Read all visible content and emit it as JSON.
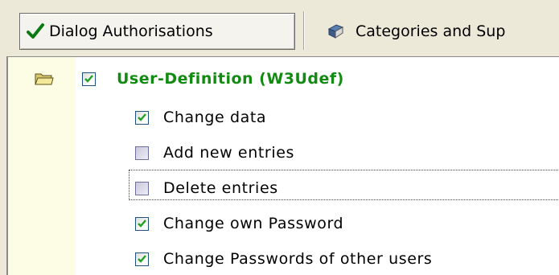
{
  "toolbar": {
    "tabs": [
      {
        "label": "Dialog Authorisations",
        "icon": "green-checkmark-icon",
        "active": true
      },
      {
        "label": "Categories and Sup",
        "icon": "book-icon",
        "active": false
      }
    ]
  },
  "tree": {
    "parent": {
      "label": "User-Definition (W3Udef)",
      "checked": true,
      "icon": "folder-open-icon",
      "color": "#138b12"
    },
    "children": [
      {
        "label": "Change data",
        "checked": true,
        "focused": false
      },
      {
        "label": "Add new entries",
        "checked": false,
        "focused": false
      },
      {
        "label": "Delete entries",
        "checked": false,
        "focused": true
      },
      {
        "label": "Change own Password",
        "checked": true,
        "focused": false
      },
      {
        "label": "Change Passwords of other users",
        "checked": true,
        "focused": false
      }
    ]
  }
}
